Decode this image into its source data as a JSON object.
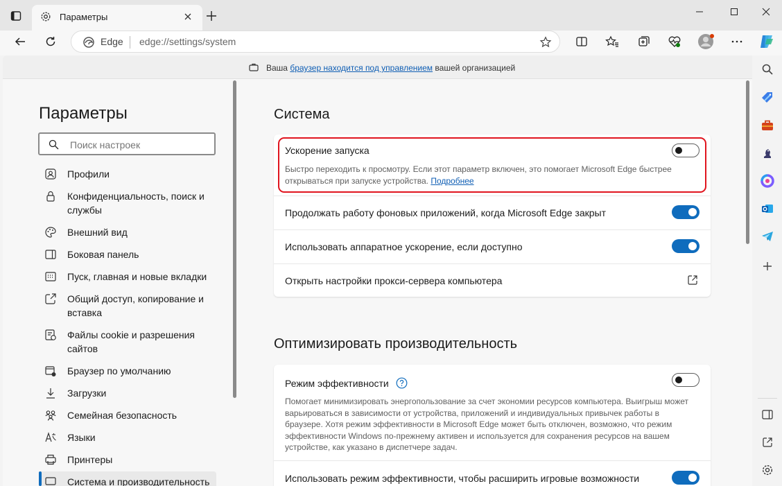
{
  "window": {
    "tab_title": "Параметры",
    "icons": [
      "tab-actions-icon",
      "settings-gear-icon",
      "close-tab-icon",
      "new-tab-icon",
      "minimize-icon",
      "maximize-icon",
      "close-window-icon"
    ]
  },
  "toolbar": {
    "address_brand": "Edge",
    "address_url": "edge://settings/system",
    "icons": [
      "back-icon",
      "refresh-icon",
      "favorite-star-icon",
      "split-screen-icon",
      "favorites-icon",
      "collections-icon",
      "browser-essentials-icon",
      "profile-avatar-icon",
      "more-icon",
      "copilot-icon"
    ]
  },
  "banner": {
    "pre": "Ваша",
    "link": "браузер находится под управлением",
    "post": "вашей организацией"
  },
  "nav": {
    "title": "Параметры",
    "search_placeholder": "Поиск настроек",
    "items": [
      {
        "label": "Профили",
        "icon": "profile-icon"
      },
      {
        "label": "Конфиденциальность, поиск и службы",
        "icon": "lock-icon"
      },
      {
        "label": "Внешний вид",
        "icon": "palette-icon"
      },
      {
        "label": "Боковая панель",
        "icon": "sidebar-icon"
      },
      {
        "label": "Пуск, главная и новые вкладки",
        "icon": "home-tabs-icon"
      },
      {
        "label": "Общий доступ, копирование и вставка",
        "icon": "share-icon"
      },
      {
        "label": "Файлы cookie и разрешения сайтов",
        "icon": "cookie-icon"
      },
      {
        "label": "Браузер по умолчанию",
        "icon": "default-browser-icon"
      },
      {
        "label": "Загрузки",
        "icon": "download-icon"
      },
      {
        "label": "Семейная безопасность",
        "icon": "family-icon"
      },
      {
        "label": "Языки",
        "icon": "language-icon"
      },
      {
        "label": "Принтеры",
        "icon": "printer-icon"
      },
      {
        "label": "Система и производительность",
        "icon": "system-icon"
      }
    ]
  },
  "system": {
    "heading": "Система",
    "startup_boost": {
      "title": "Ускорение запуска",
      "desc": "Быстро переходить к просмотру. Если этот параметр включен, это помогает Microsoft Edge быстрее открываться при запуске устройства.",
      "link": "Подробнее",
      "enabled": false
    },
    "background_apps": {
      "title": "Продолжать работу фоновых приложений, когда Microsoft Edge закрыт",
      "enabled": true
    },
    "hardware_accel": {
      "title": "Использовать аппаратное ускорение, если доступно",
      "enabled": true
    },
    "proxy": {
      "title": "Открыть настройки прокси-сервера компьютера"
    }
  },
  "performance": {
    "heading": "Оптимизировать производительность",
    "efficiency_mode": {
      "title": "Режим эффективности",
      "desc": "Помогает минимизировать энергопользование за счет экономии ресурсов компьютера. Выигрыш может варьироваться в зависимости от устройства, приложений и индивидуальных привычек работы в браузере. Хотя режим эффективности в Microsoft Edge может быть отключен, возможно, что режим эффективности Windows по-прежнему активен и используется для сохранения ресурсов на вашем устройстве, как указано в диспетчере задач.",
      "enabled": false
    },
    "gaming": {
      "title": "Использовать режим эффективности, чтобы расширить игровые возможности",
      "enabled": true
    }
  },
  "sidebar": {
    "icons": [
      "sidebar-search-icon",
      "shopping-tag-icon",
      "tools-icon",
      "games-icon",
      "microsoft365-icon",
      "outlook-icon",
      "telegram-icon",
      "add-app-icon",
      "hide-sidebar-icon",
      "open-external-icon",
      "sidebar-settings-icon"
    ]
  }
}
